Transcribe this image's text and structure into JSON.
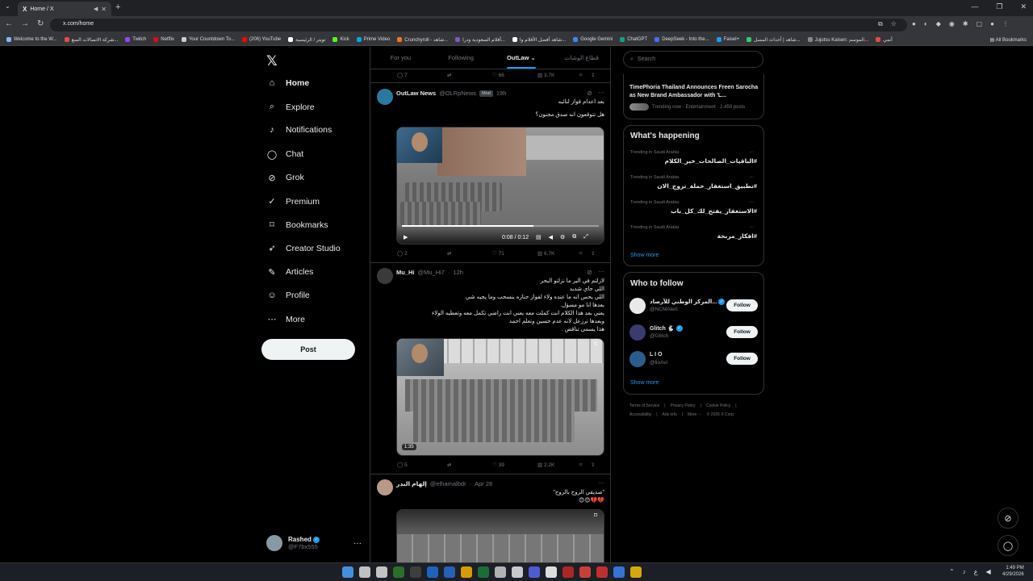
{
  "browser": {
    "tab_title": "Home / X",
    "url": "x.com/home",
    "bookmarks": [
      {
        "label": "Welcome to the W...",
        "color": "#8ab4f8"
      },
      {
        "label": "شركة الاتصالات السع...",
        "color": "#e34c4c"
      },
      {
        "label": "Twitch",
        "color": "#9146ff"
      },
      {
        "label": "Netflix",
        "color": "#e50914"
      },
      {
        "label": "Your Countdown To...",
        "color": "#cccccc"
      },
      {
        "label": "(206) YouTube",
        "color": "#ff0000"
      },
      {
        "label": "تويتر / الرئيسية",
        "color": "#ffffff"
      },
      {
        "label": "Kick",
        "color": "#53fc18"
      },
      {
        "label": "Prime Video",
        "color": "#00a8e1"
      },
      {
        "label": "Crunchyroll - شاهد...",
        "color": "#f47521"
      },
      {
        "label": "أفلام السعودية ودرا...",
        "color": "#7d57c1"
      },
      {
        "label": "شاهد أفضل الأفلام وا...",
        "color": "#ffffff"
      },
      {
        "label": "Google Gemini",
        "color": "#4285f4"
      },
      {
        "label": "ChatGPT",
        "color": "#10a37f"
      },
      {
        "label": "DeepSeek - Into the...",
        "color": "#4d6bfe"
      },
      {
        "label": "Faisel+",
        "color": "#1d9bf0"
      },
      {
        "label": "شاهد | أحداث المسل...",
        "color": "#2ecc71"
      },
      {
        "label": "Jujutsu Kaisen: الموسم...",
        "color": "#888888"
      },
      {
        "label": "أنمي",
        "color": "#e34c4c"
      }
    ],
    "all_bookmarks": "All Bookmarks"
  },
  "nav": {
    "items": [
      {
        "label": "Home",
        "icon": "home-icon",
        "glyph": "⌂"
      },
      {
        "label": "Explore",
        "icon": "search-icon",
        "glyph": "⌕"
      },
      {
        "label": "Notifications",
        "icon": "bell-icon",
        "glyph": "♪"
      },
      {
        "label": "Chat",
        "icon": "chat-icon",
        "glyph": "◯"
      },
      {
        "label": "Grok",
        "icon": "grok-icon",
        "glyph": "⊘"
      },
      {
        "label": "Premium",
        "icon": "premium-icon",
        "glyph": "✓"
      },
      {
        "label": "Bookmarks",
        "icon": "bookmark-icon",
        "glyph": "⌑"
      },
      {
        "label": "Creator Studio",
        "icon": "rocket-icon",
        "glyph": "➶"
      },
      {
        "label": "Articles",
        "icon": "articles-icon",
        "glyph": "✎"
      },
      {
        "label": "Profile",
        "icon": "profile-icon",
        "glyph": "☺"
      },
      {
        "label": "More",
        "icon": "more-icon",
        "glyph": "⋯"
      }
    ],
    "post_label": "Post",
    "account_name": "Rashed",
    "account_handle": "@F7bx555"
  },
  "feed": {
    "tabs": [
      "For you",
      "Following",
      "OutLaw",
      "قطاع الوشات"
    ],
    "top_actions": {
      "replies": "7",
      "likes": "66",
      "views": "3.7K"
    },
    "tweets": [
      {
        "name": "OutLaw News",
        "handle": "@OLRpNews",
        "badge": "Mod",
        "time": "19h",
        "lines": [
          "بعد اعدام فواز لنائبه",
          "هل تتوقعون انه صدق مجنون؟"
        ],
        "video_time": "0:08 / 0:12",
        "progress": 0.67,
        "replies": "2",
        "likes": "71",
        "views": "6.7K"
      },
      {
        "name": "Mu_Hi",
        "handle": "@Mu_Hi7",
        "time": "12h",
        "lines": [
          "لازلتم في البر ما نزلتو البحر",
          "اللي جاي شديد",
          "اللي يحس انه ما عنده ولاء لفواز جنازه ينسحب وما يجيه شي",
          "بعدها انا مو مسؤل.",
          "يعني بعد هذا الكلام انت كملت معه يعني انت راضي تكمل معه وتعطيه الولاء",
          "وبعدها ترزعل لانه عدم حسين وتعلم احمد",
          "هذا يسمى تناقض ."
        ],
        "duration": "1:35",
        "replies": "5",
        "likes": "39",
        "views": "2.2K"
      },
      {
        "name": "إلهام البدر",
        "handle": "@elhamalbdr",
        "time": "Apr 28",
        "lines": [
          "\"صديقي الروح بالروح\"",
          "💔💔😊😊"
        ]
      }
    ]
  },
  "right": {
    "search_placeholder": "Search",
    "news_title": "TimePhoria Thailand Announces Freen Sarocha as New Brand Ambassador with 'L...",
    "news_meta": "Trending now · Entertainment · 2,450 posts",
    "whats_happening": "What's happening",
    "trends": [
      {
        "context": "Trending in Saudi Arabia",
        "tag": "#الباقيات_الصالحات_خير_الكلام"
      },
      {
        "context": "Trending in Saudi Arabia",
        "tag": "#تطبيق_استغفار_حملة_تزوج_الان"
      },
      {
        "context": "Trending in Saudi Arabia",
        "tag": "#الاستغفار_يفتح_لك_كل_باب"
      },
      {
        "context": "Trending in Saudi Arabia",
        "tag": "#افكار_مربحة"
      }
    ],
    "show_more": "Show more",
    "who_to_follow": "Who to follow",
    "follow_label": "Follow",
    "suggestions": [
      {
        "name": "المركز الوطني للأرصاد...",
        "handle": "@NCMAlert",
        "color": "#e7e9ea"
      },
      {
        "name": "Glitch 🐇",
        "handle": "@Glitch",
        "color": "#3b3b6d"
      },
      {
        "name": "L I O",
        "handle": "@lioAvi",
        "color": "#2a5d8c"
      }
    ],
    "footer1": [
      "Terms of Service",
      "|",
      "Privacy Policy",
      "|",
      "Cookie Policy",
      "|"
    ],
    "footer2": [
      "Accessibility",
      "|",
      "Ads info",
      "|",
      "More ···",
      "© 2026 X Corp."
    ]
  },
  "taskbar": {
    "time": "1:49 PM",
    "date": "4/29/2026"
  }
}
